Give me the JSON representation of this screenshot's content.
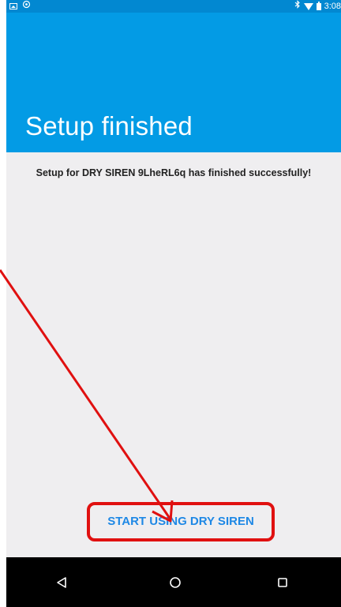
{
  "status_bar": {
    "time": "3:08",
    "left_icons": [
      "image-icon",
      "sync-icon"
    ],
    "right_icons": [
      "bluetooth-icon",
      "wifi-icon",
      "battery-icon"
    ]
  },
  "header": {
    "title": "Setup finished",
    "background_color": "#039be5"
  },
  "main": {
    "message": "Setup for DRY SIREN 9LheRL6q has finished successfully!",
    "action_button_label": "START USING DRY SIREN",
    "action_color": "#1e88e5",
    "highlight_color": "#e01010"
  },
  "nav_bar": {
    "buttons": [
      "back-icon",
      "home-icon",
      "recent-apps-icon"
    ]
  }
}
